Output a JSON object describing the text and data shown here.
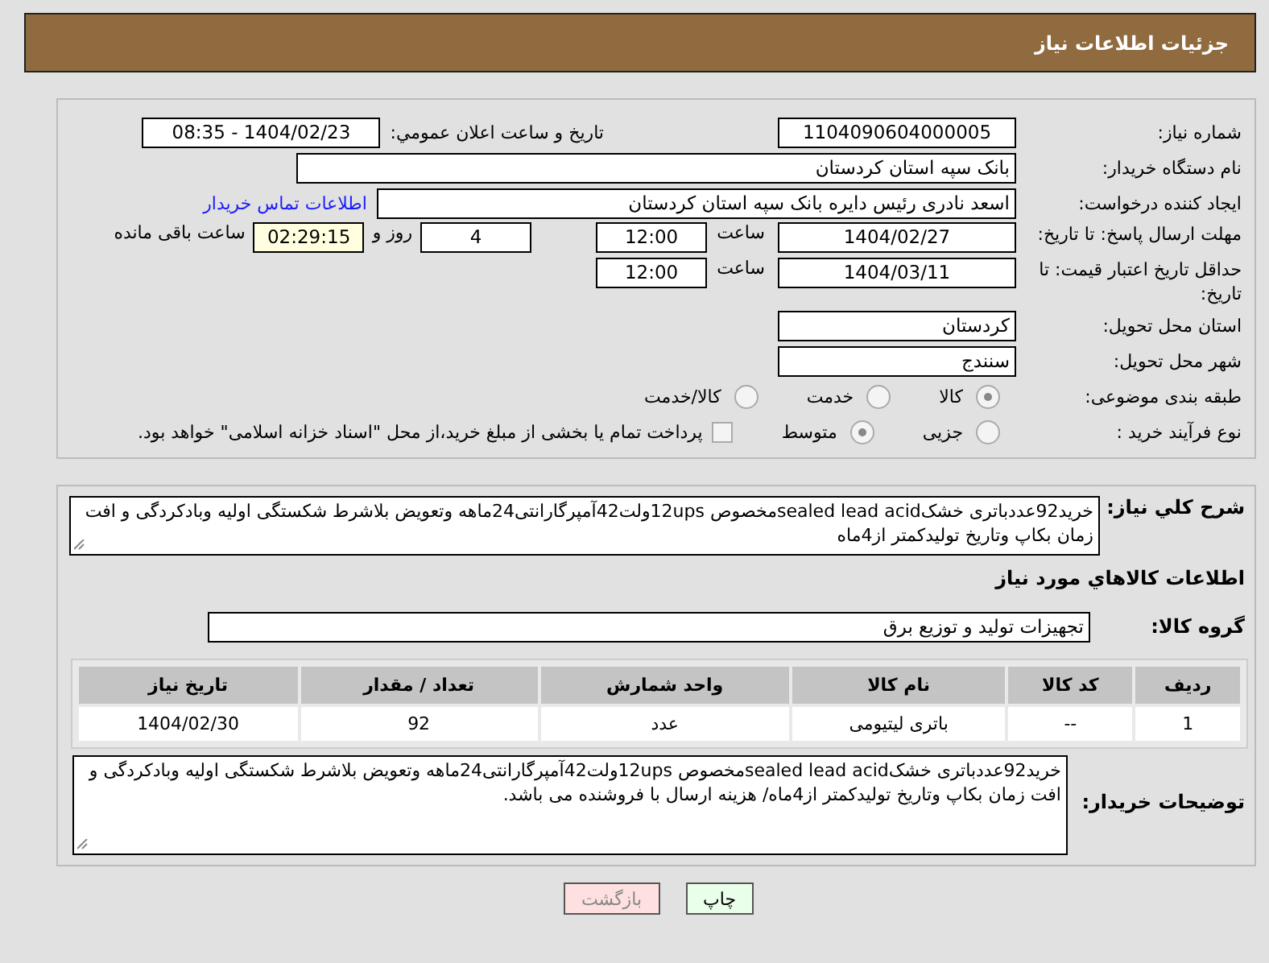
{
  "header": {
    "title": "جزئیات اطلاعات نیاز"
  },
  "need_number": {
    "label": "شماره نیاز:",
    "value": "1104090604000005"
  },
  "announce": {
    "label": "تاریخ و ساعت اعلان عمومي:",
    "value": "1404/02/23 - 08:35"
  },
  "buyer_org": {
    "label": "نام دستگاه خریدار:",
    "value": "بانک سپه استان کردستان"
  },
  "requester": {
    "label": "ایجاد کننده درخواست:",
    "value": "اسعد نادری رئیس دایره بانک سپه استان کردستان",
    "link": "اطلاعات تماس خریدار"
  },
  "deadline": {
    "label": "مهلت ارسال پاسخ: تا تاریخ:",
    "date": "1404/02/27",
    "time_label": "ساعت",
    "time": "12:00",
    "days": "4",
    "days_label": "روز و",
    "remaining": "02:29:15",
    "remaining_label": "ساعت باقی مانده"
  },
  "validity": {
    "label": "حداقل تاریخ اعتبار قیمت: تا تاریخ:",
    "date": "1404/03/11",
    "time_label": "ساعت",
    "time": "12:00"
  },
  "province": {
    "label": "استان محل تحویل:",
    "value": "کردستان"
  },
  "city": {
    "label": "شهر محل تحویل:",
    "value": "سنندج"
  },
  "category": {
    "label": "طبقه بندی موضوعی:",
    "options": [
      {
        "label": "کالا",
        "selected": true
      },
      {
        "label": "خدمت",
        "selected": false
      },
      {
        "label": "کالا/خدمت",
        "selected": false
      }
    ]
  },
  "process": {
    "label": "نوع فرآیند خرید :",
    "options": [
      {
        "label": "جزیی",
        "selected": false
      },
      {
        "label": "متوسط",
        "selected": true
      }
    ],
    "payment_note": {
      "label": "پرداخت تمام یا بخشی از مبلغ خرید،از محل \"اسناد خزانه اسلامی\" خواهد بود.",
      "checked": false
    }
  },
  "description": {
    "label": "شرح كلي نياز:",
    "value": "خرید92عددباتری خشکsealed lead acidمخصوص 12upsولت42آمپرگارانتی24ماهه وتعویض بلاشرط شکستگی اولیه وبادکردگی و افت زمان بکاپ وتاریخ تولیدکمتر از4ماه"
  },
  "goods": {
    "title": "اطلاعات كالاهاي مورد نياز",
    "group_label": "گروه کالا:",
    "group": "تجهیزات تولید و توزیع برق",
    "columns": [
      "ردیف",
      "کد کالا",
      "نام کالا",
      "واحد شمارش",
      "تعداد / مقدار",
      "تاریخ نیاز"
    ],
    "rows": [
      [
        "1",
        "--",
        "باتری لیتیومی",
        "عدد",
        "92",
        "1404/02/30"
      ]
    ]
  },
  "buyer_notes": {
    "label": "توضیحات خریدار:",
    "value": "خرید92عددباتری خشکsealed lead acidمخصوص 12upsولت42آمپرگارانتی24ماهه وتعویض بلاشرط شکستگی اولیه وبادکردگی و افت زمان بکاپ وتاریخ تولیدکمتر از4ماه/ هزینه ارسال با فروشنده می باشد."
  },
  "buttons": [
    {
      "label": "چاپ",
      "kind": "print"
    },
    {
      "label": "بازگشت",
      "kind": "back"
    }
  ]
}
